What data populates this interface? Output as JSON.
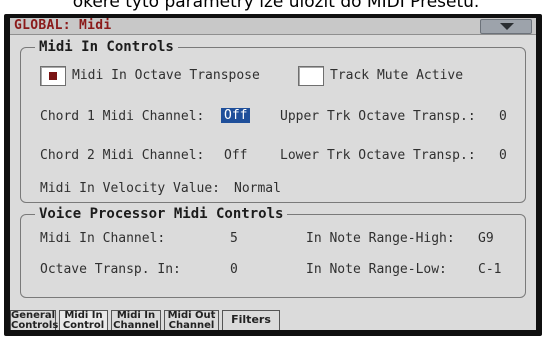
{
  "caption": "ôkeré tyto parametry lze uložit do MIDI Presetu.",
  "header": {
    "title": "GLOBAL: Midi",
    "menu_icon": "triangle-down-icon"
  },
  "midi_in_controls": {
    "title": "Midi In Controls",
    "octave_transpose": {
      "label": "Midi In Octave Transpose",
      "checked": true
    },
    "track_mute_active": {
      "label": "Track Mute Active",
      "checked": false
    },
    "chord1_label": "Chord 1 Midi Channel:",
    "chord1_value": "Off",
    "chord2_label": "Chord 2 Midi Channel:",
    "chord2_value": "Off",
    "upper_label": "Upper Trk Octave Transp.:",
    "upper_value": "0",
    "lower_label": "Lower Trk Octave Transp.:",
    "lower_value": "0",
    "velocity_label": "Midi In Velocity Value:",
    "velocity_value": "Normal"
  },
  "voice_processor": {
    "title": "Voice Processor Midi Controls",
    "channel_label": "Midi In Channel:",
    "channel_value": "5",
    "octave_label": "Octave Transp. In:",
    "octave_value": "0",
    "range_high_label": "In Note Range-High:",
    "range_high_value": "G9",
    "range_low_label": "In Note Range-Low:",
    "range_low_value": "C-1"
  },
  "tabs": [
    {
      "line1": "General",
      "line2": "Controls"
    },
    {
      "line1": "Midi In",
      "line2": "Control"
    },
    {
      "line1": "Midi In",
      "line2": "Channel"
    },
    {
      "line1": "Midi Out",
      "line2": "Channel"
    },
    {
      "line1": "Filters",
      "line2": ""
    }
  ],
  "active_tab_index": 1,
  "colors": {
    "title_color": "#8b1a1a",
    "selection_bg": "#1f4f9a",
    "checkbox_mark": "#7a1414",
    "screen_bg": "#dbdbdb"
  }
}
